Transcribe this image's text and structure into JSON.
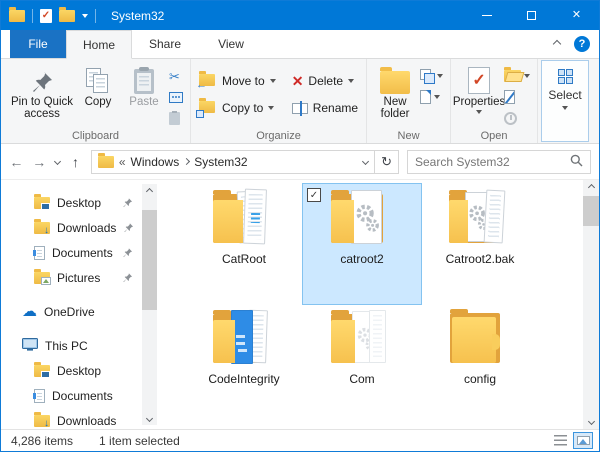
{
  "colors": {
    "accent": "#0078d7",
    "selection_bg": "#cce8ff",
    "selection_border": "#84c3f0",
    "folder_front": "#ffd96d",
    "folder_back": "#e2a33c"
  },
  "titlebar": {
    "title": "System32"
  },
  "tabs": {
    "file": "File",
    "home": "Home",
    "share": "Share",
    "view": "View"
  },
  "ribbon": {
    "pin": "Pin to Quick access",
    "copy": "Copy",
    "paste": "Paste",
    "move_to": "Move to",
    "copy_to": "Copy to",
    "delete": "Delete",
    "rename": "Rename",
    "new_folder": "New folder",
    "properties": "Properties",
    "select": "Select",
    "groups": {
      "clipboard": "Clipboard",
      "organize": "Organize",
      "new": "New",
      "open": "Open"
    }
  },
  "address": {
    "breadcrumb_root": "Windows",
    "breadcrumb_current": "System32",
    "search_placeholder": "Search System32"
  },
  "sidebar": {
    "items": [
      {
        "label": "Desktop",
        "pinned": true
      },
      {
        "label": "Downloads",
        "pinned": true
      },
      {
        "label": "Documents",
        "pinned": true
      },
      {
        "label": "Pictures",
        "pinned": true
      },
      {
        "label": "OneDrive",
        "pinned": false
      },
      {
        "label": "This PC",
        "pinned": false
      },
      {
        "label": "Desktop",
        "pinned": false
      },
      {
        "label": "Documents",
        "pinned": false
      },
      {
        "label": "Downloads",
        "pinned": false
      }
    ]
  },
  "files": [
    {
      "name": "CatRoot",
      "selected": false
    },
    {
      "name": "catroot2",
      "selected": true
    },
    {
      "name": "Catroot2.bak",
      "selected": false
    },
    {
      "name": "CodeIntegrity",
      "selected": false
    },
    {
      "name": "Com",
      "selected": false
    },
    {
      "name": "config",
      "selected": false
    }
  ],
  "status": {
    "count": "4,286 items",
    "selected": "1 item selected"
  },
  "icons": {
    "cut": "✂",
    "check": "✓",
    "close": "✕",
    "refresh": "↻",
    "cloud": "☁",
    "guillemet": "«",
    "crumb_sep": "›",
    "help": "?",
    "back": "←",
    "forward": "→",
    "up": "↑",
    "move_arrow": "←",
    "download_arrow": "↓"
  }
}
